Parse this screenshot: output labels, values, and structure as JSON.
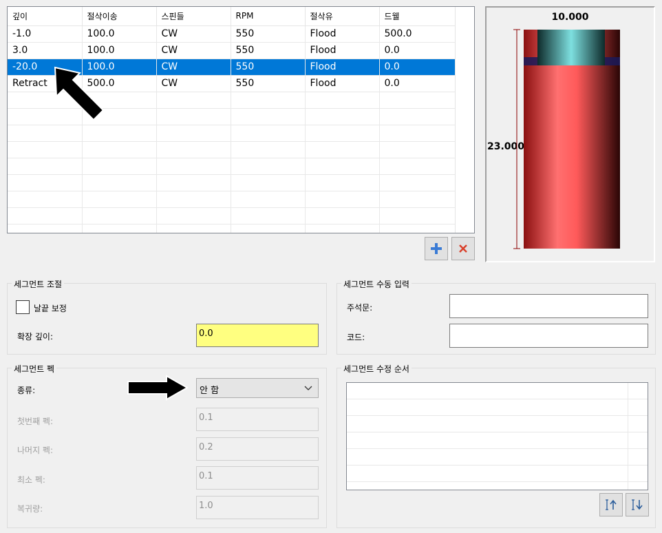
{
  "grid": {
    "columns": [
      "깊이",
      "절삭이송",
      "스핀들",
      "RPM",
      "절삭유",
      "드웰"
    ],
    "rows": [
      [
        "-1.0",
        "100.0",
        "CW",
        "550",
        "Flood",
        "500.0"
      ],
      [
        "3.0",
        "100.0",
        "CW",
        "550",
        "Flood",
        "0.0"
      ],
      [
        "-20.0",
        "100.0",
        "CW",
        "550",
        "Flood",
        "0.0"
      ],
      [
        "Retract",
        "500.0",
        "CW",
        "550",
        "Flood",
        "0.0"
      ]
    ],
    "selected_row": 2,
    "add_icon": "plus-icon",
    "delete_icon": "x-icon"
  },
  "preview": {
    "diameter_label": "10.000",
    "length_label": "23.000"
  },
  "segment_adjust": {
    "title": "세그먼트 조절",
    "checkbox_label": "날끝 보정",
    "checkbox_checked": false,
    "extend_depth_label": "확장 깊이:",
    "extend_depth_value": "0.0"
  },
  "manual_input": {
    "title": "세그먼트 수동 입력",
    "comment_label": "주석문:",
    "comment_value": "",
    "code_label": "코드:",
    "code_value": ""
  },
  "peck": {
    "title": "세그먼트 펙",
    "type_label": "종류:",
    "type_value": "안 함",
    "first_label": "첫번째 펙:",
    "first_value": "0.1",
    "rest_label": "나머지 펙:",
    "rest_value": "0.2",
    "min_label": "최소 펙:",
    "min_value": "0.1",
    "return_label": "복귀량:",
    "return_value": "1.0"
  },
  "edit_order": {
    "title": "세그먼트 수정 순서",
    "move_up_icon": "move-up-icon",
    "move_down_icon": "move-down-icon"
  },
  "colors": {
    "selection": "#0078d7",
    "highlight_input": "#ffff80",
    "tool_body": "#ff6a6a",
    "tool_holder": "#6fd6d6"
  }
}
